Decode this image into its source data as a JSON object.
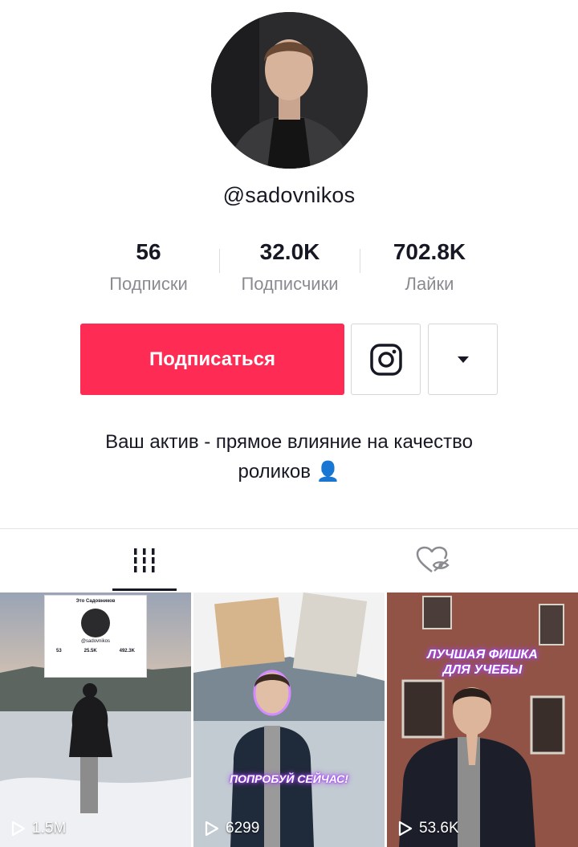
{
  "profile": {
    "username": "@sadovnikos",
    "bio_line1": "Ваш актив - прямое влияние на качество",
    "bio_line2": "роликов 👤"
  },
  "stats": [
    {
      "value": "56",
      "label": "Подписки"
    },
    {
      "value": "32.0K",
      "label": "Подписчики"
    },
    {
      "value": "702.8K",
      "label": "Лайки"
    }
  ],
  "actions": {
    "follow_label": "Подписаться",
    "instagram_icon": "instagram-icon",
    "more_icon": "caret-down-icon",
    "accent": "#fe2c55"
  },
  "tabs": [
    {
      "icon": "grid-icon",
      "active": true
    },
    {
      "icon": "liked-hidden-icon",
      "active": false
    }
  ],
  "videos": [
    {
      "views": "1.5M",
      "mini_profile": {
        "name": "Это Садовников",
        "username": "@sadovnikos",
        "stats": [
          "53",
          "25.5K",
          "492.3K"
        ]
      }
    },
    {
      "views": "6299",
      "caption": "ПОПРОБУЙ СЕЙЧАС!"
    },
    {
      "views": "53.6K",
      "caption_line1": "ЛУЧШАЯ ФИШКА",
      "caption_line2": "ДЛЯ УЧЕБЫ"
    }
  ]
}
